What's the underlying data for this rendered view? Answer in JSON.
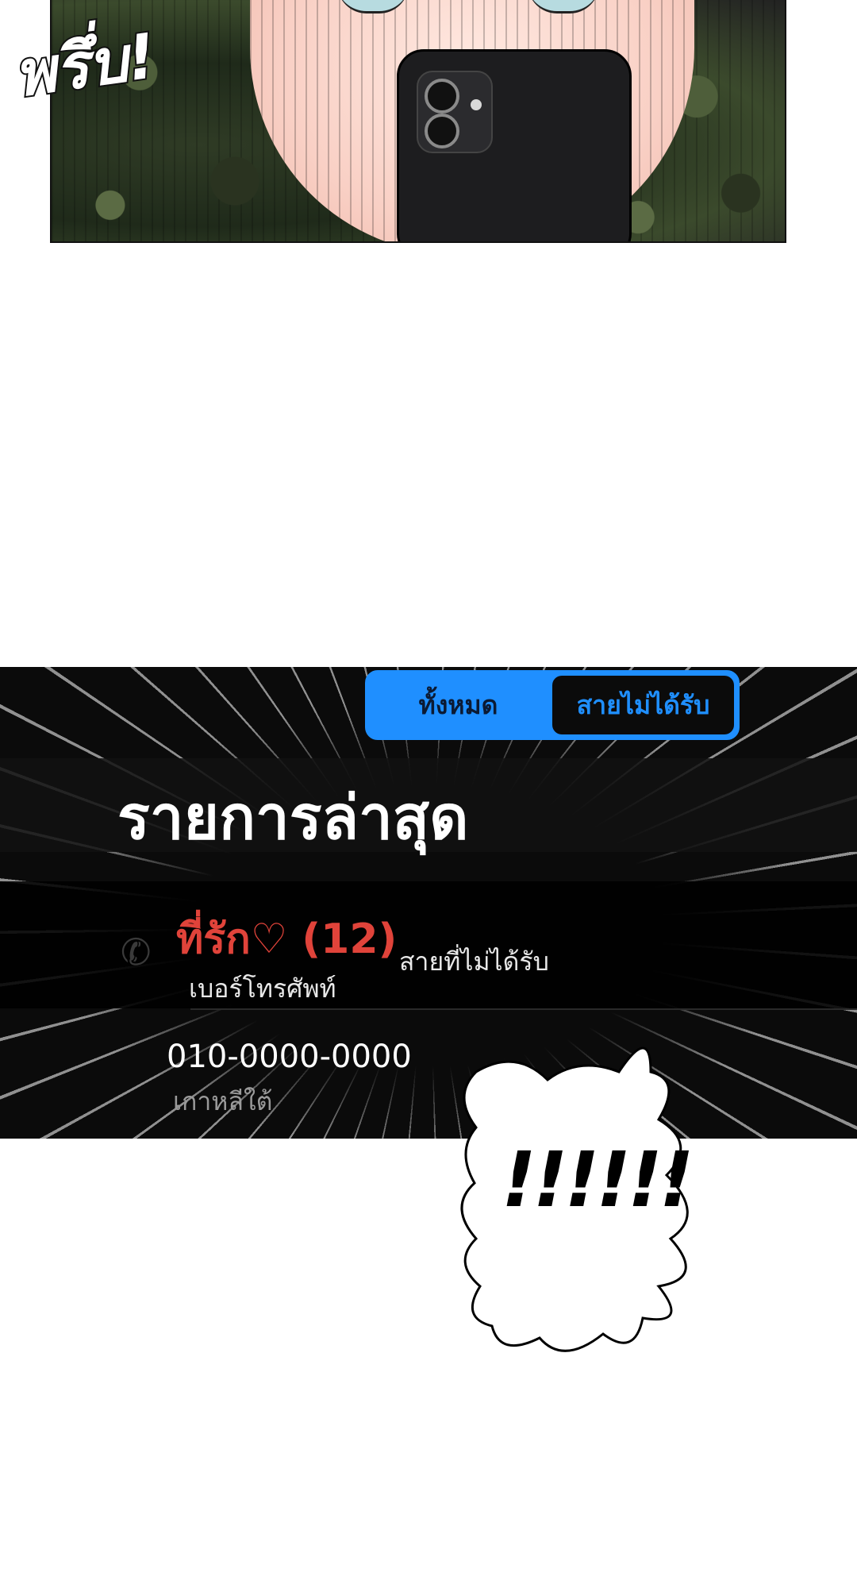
{
  "panel_top": {
    "sfx": "พรึ่บ!"
  },
  "call_log": {
    "tabs": [
      {
        "label": "ทั้งหมด",
        "selected": false
      },
      {
        "label": "สายไม่ได้รับ",
        "selected": true
      }
    ],
    "title": "รายการล่าสุด",
    "entry": {
      "name": "ที่รัก♡ (12)",
      "type": "เบอร์โทรศัพท์",
      "status": "สายที่ไม่ได้รับ",
      "number": "010-0000-0000",
      "country": "เกาหลีใต้"
    },
    "colors": {
      "accent": "#1f8fff",
      "missed": "#e0433a",
      "background": "#0b0b0b"
    }
  },
  "bubble": {
    "text": "!!!!!!"
  }
}
